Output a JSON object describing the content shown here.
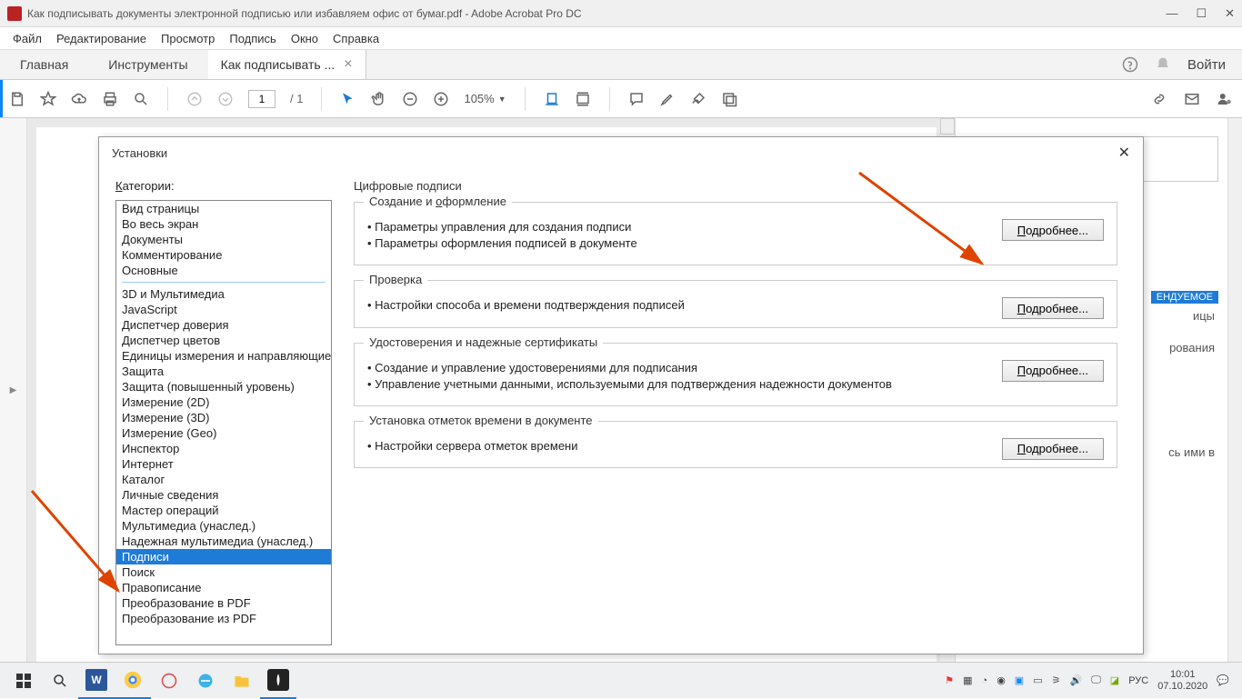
{
  "titlebar": {
    "title": "Как подписывать документы электронной подписью или избавляем офис от бумаг.pdf - Adobe Acrobat Pro DC"
  },
  "menu": {
    "file": "Файл",
    "edit": "Редактирование",
    "view": "Просмотр",
    "sign": "Подпись",
    "window": "Окно",
    "help": "Справка"
  },
  "tabs": {
    "home": "Главная",
    "tools": "Инструменты",
    "doc": "Как подписывать ...",
    "signin": "Войти"
  },
  "toolbar": {
    "page": "1",
    "total": "/ 1",
    "zoom": "105%"
  },
  "rightpanel": {
    "badge": "ЕНДУЕМОЕ",
    "line1": "ицы",
    "line2": "рования",
    "line3": "сь ими в"
  },
  "dialog": {
    "title": "Установки",
    "cat_label": "Категории:",
    "categories_a": [
      "Вид страницы",
      "Во весь экран",
      "Документы",
      "Комментирование",
      "Основные"
    ],
    "categories_b": [
      "3D и Мультимедиа",
      "JavaScript",
      "Диспетчер доверия",
      "Диспетчер цветов",
      "Единицы измерения и направляющие",
      "Защита",
      "Защита (повышенный уровень)",
      "Измерение (2D)",
      "Измерение (3D)",
      "Измерение (Geo)",
      "Инспектор",
      "Интернет",
      "Каталог",
      "Личные сведения",
      "Мастер операций",
      "Мультимедиа (унаслед.)",
      "Надежная мультимедиа (унаслед.)",
      "Подписи",
      "Поиск",
      "Правописание",
      "Преобразование в PDF",
      "Преобразование из PDF"
    ],
    "selected": "Подписи",
    "section_title": "Цифровые подписи",
    "more": "Подробнее...",
    "fs1": {
      "legend": "Создание и оформление",
      "b1": "Параметры управления для создания подписи",
      "b2": "Параметры оформления подписей в документе"
    },
    "fs2": {
      "legend": "Проверка",
      "b1": "Настройки способа и времени подтверждения подписей"
    },
    "fs3": {
      "legend": "Удостоверения и надежные сертификаты",
      "b1": "Создание и управление удостоверениями для подписания",
      "b2": "Управление учетными данными, используемыми для подтверждения надежности документов"
    },
    "fs4": {
      "legend": "Установка отметок времени в документе",
      "b1": "Настройки сервера отметок времени"
    }
  },
  "tray": {
    "lang": "РУС",
    "time": "10:01",
    "date": "07.10.2020"
  }
}
